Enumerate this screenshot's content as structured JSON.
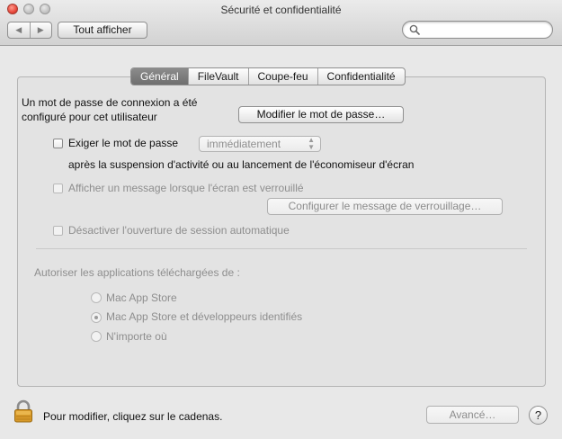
{
  "window": {
    "title": "Sécurité et confidentialité"
  },
  "toolbar": {
    "back_glyph": "◀",
    "forward_glyph": "▶",
    "show_all_label": "Tout afficher",
    "search_placeholder": "",
    "search_icon": "magnifier-icon"
  },
  "tabs": [
    {
      "label": "Général",
      "active": true
    },
    {
      "label": "FileVault",
      "active": false
    },
    {
      "label": "Coupe-feu",
      "active": false
    },
    {
      "label": "Confidentialité",
      "active": false
    }
  ],
  "general": {
    "password_set_text": "Un mot de passe de connexion a été configuré pour cet utilisateur",
    "change_password_label": "Modifier le mot de passe…",
    "require_password_label": "Exiger le mot de passe",
    "require_password_checked": false,
    "require_password_delay": "immédiatement",
    "after_sleep_text": "après la suspension d'activité ou au lancement de l'économiseur d'écran",
    "show_message_label": "Afficher un message lorsque l'écran est verrouillé",
    "set_lock_message_label": "Configurer le message de verrouillage…",
    "disable_autologin_label": "Désactiver l'ouverture de session automatique",
    "allow_apps_label": "Autoriser les applications téléchargées de :",
    "app_sources": [
      {
        "label": "Mac App Store",
        "selected": false
      },
      {
        "label": "Mac App Store et développeurs identifiés",
        "selected": true
      },
      {
        "label": "N'importe où",
        "selected": false
      }
    ]
  },
  "footer": {
    "lock_icon": "padlock-icon",
    "lock_message": "Pour modifier, cliquez sur le cadenas.",
    "advanced_label": "Avancé…",
    "help_label": "?"
  },
  "colors": {
    "active_tab": "#7d7d7d",
    "close_button": "#e8473b",
    "disabled_text": "#8e8e8e"
  }
}
